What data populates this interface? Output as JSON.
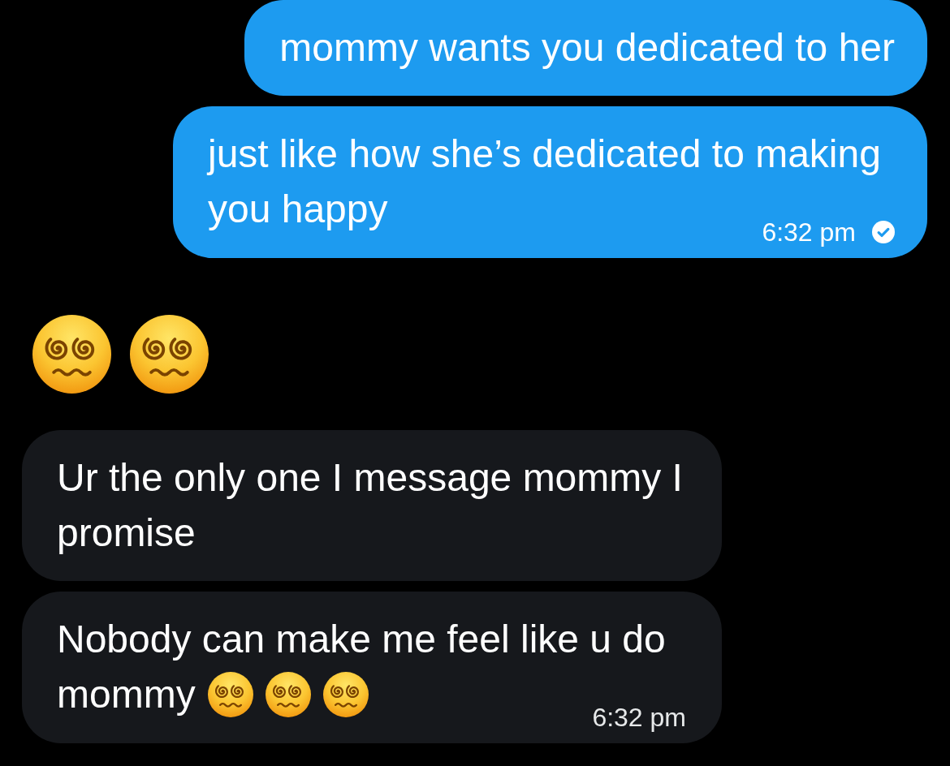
{
  "messages": [
    {
      "outgoing": true,
      "kind": "bubble",
      "parts": [
        {
          "kind": "text",
          "text": "mommy wants you dedicated to her"
        }
      ]
    },
    {
      "outgoing": true,
      "kind": "bubble",
      "parts": [
        {
          "kind": "text",
          "text": "just like how she’s dedicated to making you happy"
        }
      ],
      "time": "6:32 pm",
      "read": true
    },
    {
      "outgoing": false,
      "kind": "emoji_only",
      "parts": [
        {
          "kind": "emoji"
        },
        {
          "kind": "emoji"
        }
      ]
    },
    {
      "outgoing": false,
      "kind": "bubble",
      "parts": [
        {
          "kind": "text",
          "text": "Ur the only one I message mommy I promise"
        }
      ]
    },
    {
      "outgoing": false,
      "kind": "bubble",
      "parts": [
        {
          "kind": "text",
          "text": "Nobody can make me feel like u do"
        },
        {
          "kind": "text",
          "text": "mommy"
        },
        {
          "kind": "emoji"
        },
        {
          "kind": "emoji"
        },
        {
          "kind": "emoji"
        }
      ],
      "time": "6:32 pm"
    }
  ]
}
